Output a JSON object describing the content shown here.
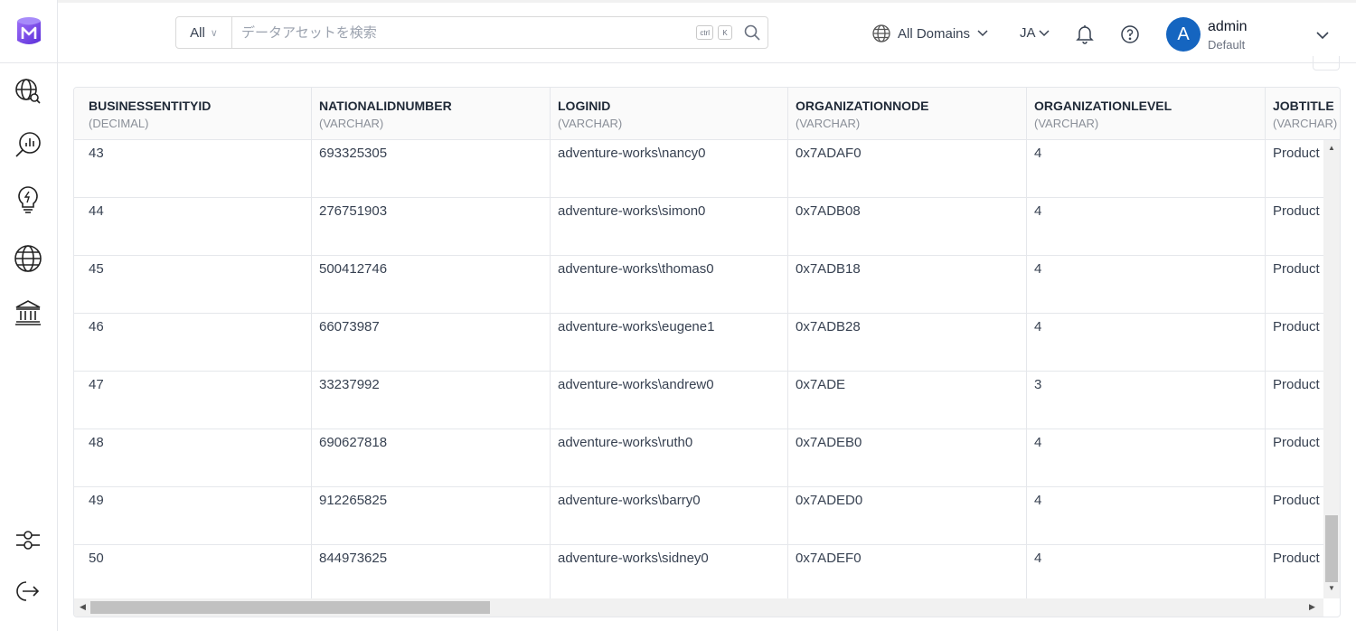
{
  "header": {
    "search_scope": "All",
    "search_placeholder": "データアセットを検索",
    "kbd_ctrl": "ctrl",
    "kbd_k": "K",
    "domains_label": "All Domains",
    "language": "JA",
    "user_initial": "A",
    "user_name": "admin",
    "user_role": "Default"
  },
  "sidebar": {
    "items": [
      "explore-icon",
      "data-insights-icon",
      "data-quality-icon",
      "domains-icon",
      "governance-icon"
    ],
    "bottom": [
      "settings-icon",
      "logout-icon"
    ]
  },
  "table": {
    "columns": [
      {
        "name": "BUSINESSENTITYID",
        "type": "(DECIMAL)"
      },
      {
        "name": "NATIONALIDNUMBER",
        "type": "(VARCHAR)"
      },
      {
        "name": "LOGINID",
        "type": "(VARCHAR)"
      },
      {
        "name": "ORGANIZATIONNODE",
        "type": "(VARCHAR)"
      },
      {
        "name": "ORGANIZATIONLEVEL",
        "type": "(VARCHAR)"
      },
      {
        "name": "JOBTITLE",
        "type": "(VARCHAR)"
      }
    ],
    "rows": [
      [
        "43",
        "693325305",
        "adventure-works\\nancy0",
        "0x7ADAF0",
        "4",
        "Product"
      ],
      [
        "44",
        "276751903",
        "adventure-works\\simon0",
        "0x7ADB08",
        "4",
        "Product"
      ],
      [
        "45",
        "500412746",
        "adventure-works\\thomas0",
        "0x7ADB18",
        "4",
        "Product"
      ],
      [
        "46",
        "66073987",
        "adventure-works\\eugene1",
        "0x7ADB28",
        "4",
        "Product"
      ],
      [
        "47",
        "33237992",
        "adventure-works\\andrew0",
        "0x7ADE",
        "3",
        "Product"
      ],
      [
        "48",
        "690627818",
        "adventure-works\\ruth0",
        "0x7ADEB0",
        "4",
        "Product"
      ],
      [
        "49",
        "912265825",
        "adventure-works\\barry0",
        "0x7ADED0",
        "4",
        "Product"
      ],
      [
        "50",
        "844973625",
        "adventure-works\\sidney0",
        "0x7ADEF0",
        "4",
        "Product"
      ]
    ]
  },
  "colors": {
    "brand": "#7147e8",
    "avatar": "#1565c0",
    "border": "#e5e7eb"
  }
}
